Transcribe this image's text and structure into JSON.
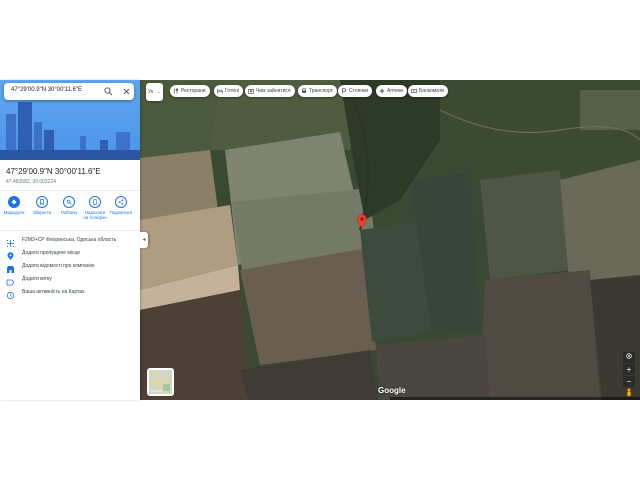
{
  "search": {
    "query": "47°29'00.9\"N 30°00'11.6\"E"
  },
  "place": {
    "title": "47°29'00.9\"N 30°00'11.6\"E",
    "coords": "47.483582, 30.003224"
  },
  "actions": [
    {
      "label": "Маршрути",
      "icon": "directions-icon"
    },
    {
      "label": "Зберегти",
      "icon": "bookmark-icon"
    },
    {
      "label": "Поблизу",
      "icon": "nearby-icon"
    },
    {
      "label": "Надіслати на телефон",
      "icon": "send-to-phone-icon"
    },
    {
      "label": "Поділитися",
      "icon": "share-icon"
    }
  ],
  "info": [
    {
      "text": "F2M3+CP Флоринська, Одеська область",
      "icon": "plus-code-icon"
    },
    {
      "text": "Додати пропущене місце",
      "icon": "add-place-icon"
    },
    {
      "text": "Додати відомості про компанію",
      "icon": "business-icon"
    },
    {
      "text": "Додати мітку",
      "icon": "label-icon"
    },
    {
      "text": "Ваша активність на Картах",
      "icon": "history-icon"
    }
  ],
  "map": {
    "language_label": "Ук",
    "chips": [
      {
        "label": "Ресторани",
        "icon": "restaurant-icon"
      },
      {
        "label": "Готелі",
        "icon": "hotel-icon"
      },
      {
        "label": "Чим зайнятися",
        "icon": "things-to-do-icon"
      },
      {
        "label": "Транспорт",
        "icon": "transit-icon"
      },
      {
        "label": "Стоянки",
        "icon": "parking-icon"
      },
      {
        "label": "Аптеки",
        "icon": "pharmacy-icon"
      },
      {
        "label": "Банкомати",
        "icon": "atm-icon"
      }
    ],
    "layers_label": "Шари",
    "attribution": "Google",
    "zoom_in": "+",
    "zoom_out": "−",
    "accent": "#1a73e8",
    "pin_color": "#ea4335"
  }
}
